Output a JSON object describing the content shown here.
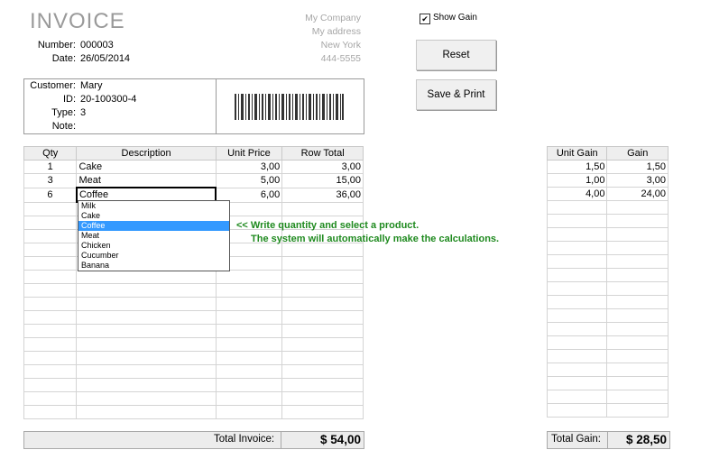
{
  "invoice": {
    "title": "INVOICE",
    "number_label": "Number:",
    "number": "000003",
    "date_label": "Date:",
    "date": "26/05/2014"
  },
  "company": {
    "name": "My Company",
    "address": "My address",
    "city": "New York",
    "phone": "444-5555"
  },
  "show_gain": {
    "label": "Show Gain",
    "checked": true
  },
  "buttons": {
    "reset": "Reset",
    "save_print": "Save & Print"
  },
  "customer": {
    "customer_label": "Customer:",
    "customer": "Mary",
    "id_label": "ID:",
    "id": "20-100300-4",
    "type_label": "Type:",
    "type": "3",
    "note_label": "Note:",
    "note": ""
  },
  "items_table": {
    "headers": [
      "Qty",
      "Description",
      "Unit Price",
      "Row Total"
    ],
    "rows": [
      {
        "qty": "1",
        "desc": "Cake",
        "price": "3,00",
        "total": "3,00"
      },
      {
        "qty": "3",
        "desc": "Meat",
        "price": "5,00",
        "total": "15,00"
      },
      {
        "qty": "6",
        "desc": "Coffee",
        "price": "6,00",
        "total": "36,00"
      }
    ]
  },
  "gain_table": {
    "headers": [
      "Unit Gain",
      "Gain"
    ],
    "rows": [
      {
        "unit": "1,50",
        "gain": "1,50"
      },
      {
        "unit": "1,00",
        "gain": "3,00"
      },
      {
        "unit": "4,00",
        "gain": "24,00"
      }
    ]
  },
  "dropdown": {
    "options": [
      "Milk",
      "Cake",
      "Coffee",
      "Meat",
      "Chicken",
      "Cucumber",
      "Banana"
    ],
    "selected": "Coffee"
  },
  "hint": {
    "line1": "<< Write quantity and select a product.",
    "line2": "The system will automatically make the calculations."
  },
  "totals": {
    "invoice_label": "Total Invoice:",
    "invoice_value": "$ 54,00",
    "gain_label": "Total Gain:",
    "gain_value": "$ 28,50"
  },
  "colors": {
    "hint_green": "#1f8a1f",
    "title_gray": "#9a9a9a",
    "dropdown_highlight": "#3399ff"
  }
}
